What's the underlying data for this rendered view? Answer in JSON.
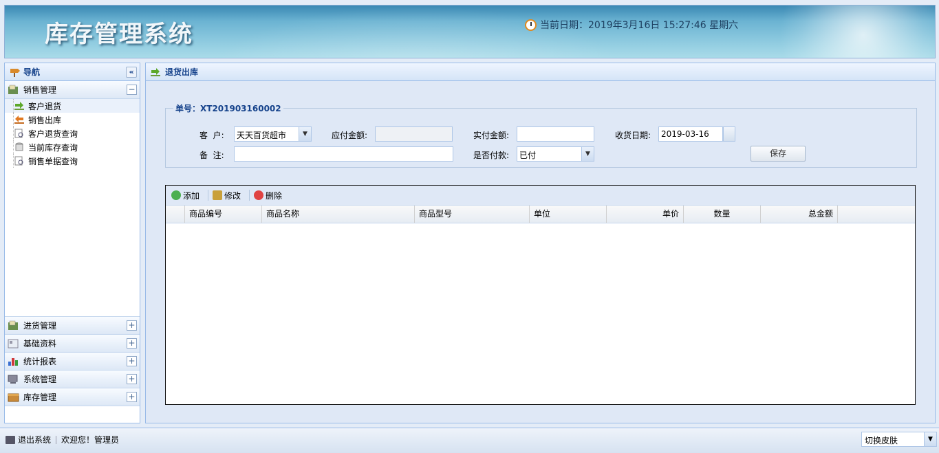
{
  "header": {
    "title": "库存管理系统",
    "datetime": "当前日期：2019年3月16日 15:27:46 星期六"
  },
  "nav": {
    "title": "导航",
    "open_section": {
      "label": "销售管理",
      "items": [
        {
          "label": "客户退货"
        },
        {
          "label": "销售出库"
        },
        {
          "label": "客户退货查询"
        },
        {
          "label": "当前库存查询"
        },
        {
          "label": "销售单据查询"
        }
      ]
    },
    "sections": [
      {
        "label": "进货管理"
      },
      {
        "label": "基础资料"
      },
      {
        "label": "统计报表"
      },
      {
        "label": "系统管理"
      },
      {
        "label": "库存管理"
      }
    ]
  },
  "main": {
    "title": "退货出库",
    "form": {
      "legend": "单号：XT201903160002",
      "customer_label": "客  户:",
      "customer_value": "天天百货超市",
      "payable_label": "应付金额:",
      "payable_value": "",
      "paid_label": "实付金额:",
      "paid_value": "",
      "date_label": "收货日期:",
      "date_value": "2019-03-16",
      "remark_label": "备  注:",
      "remark_value": "",
      "is_paid_label": "是否付款:",
      "is_paid_value": "已付",
      "save_label": "保存"
    },
    "toolbar": {
      "add": "添加",
      "edit": "修改",
      "delete": "删除"
    },
    "columns": [
      "商品编号",
      "商品名称",
      "商品型号",
      "单位",
      "单价",
      "数量",
      "总金额"
    ]
  },
  "footer": {
    "logout": "退出系统",
    "welcome": "欢迎您！管理员",
    "skin": "切换皮肤"
  }
}
